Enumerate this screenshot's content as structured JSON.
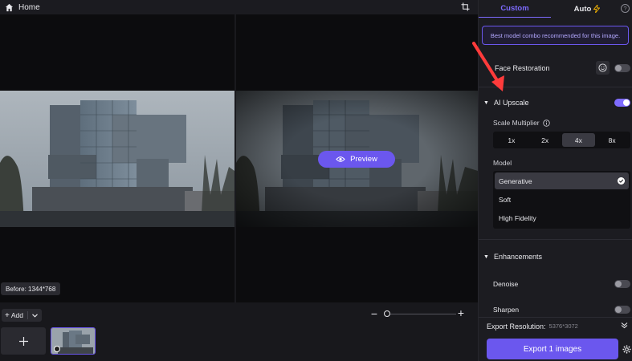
{
  "topbar": {
    "home_label": "Home"
  },
  "stage": {
    "preview_label": "Preview",
    "before_label": "Before: 1344*768"
  },
  "bottombar": {
    "add_label": "Add"
  },
  "panel": {
    "tabs": {
      "custom": "Custom",
      "auto": "Auto"
    },
    "recommend_text": "Best model combo recommended for this image.",
    "face_restoration": {
      "label": "Face Restoration",
      "enabled": false
    },
    "ai_upscale": {
      "label": "AI Upscale",
      "enabled": true,
      "scale_label": "Scale Multiplier",
      "scale_options": [
        "1x",
        "2x",
        "4x",
        "8x"
      ],
      "scale_selected": "4x",
      "model_label": "Model",
      "models": [
        "Generative",
        "Soft",
        "High Fidelity"
      ],
      "model_selected": "Generative"
    },
    "enhancements": {
      "label": "Enhancements",
      "denoise": {
        "label": "Denoise",
        "enabled": false
      },
      "sharpen": {
        "label": "Sharpen",
        "enabled": false
      }
    },
    "export_resolution_label": "Export Resolution:",
    "export_resolution_value": "5376*3072",
    "export_button": "Export 1 images"
  },
  "colors": {
    "accent": "#6b57ee",
    "accent_light": "#7e6bff",
    "annotation_arrow": "#ff3b3b"
  }
}
